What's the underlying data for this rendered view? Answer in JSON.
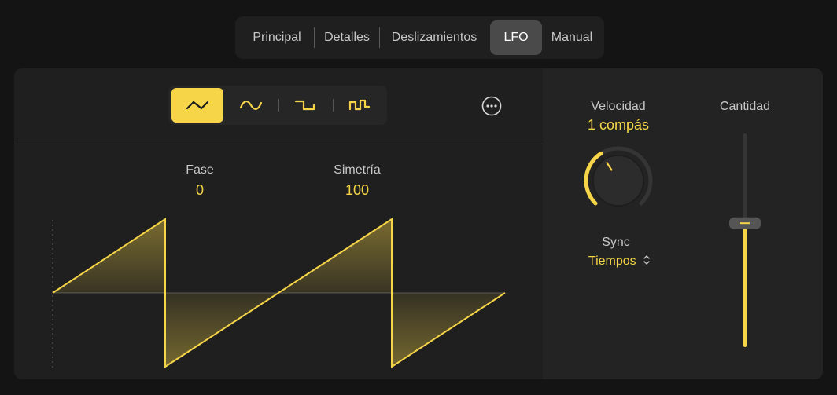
{
  "tabs": [
    {
      "label": "Principal",
      "active": false
    },
    {
      "label": "Detalles",
      "active": false
    },
    {
      "label": "Deslizamientos",
      "active": false
    },
    {
      "label": "LFO",
      "active": true
    },
    {
      "label": "Manual",
      "active": false
    }
  ],
  "waveforms": [
    {
      "icon": "triangle-wave-icon",
      "active": true
    },
    {
      "icon": "sine-wave-icon",
      "active": false
    },
    {
      "icon": "square-wave-icon",
      "active": false
    },
    {
      "icon": "sample-hold-wave-icon",
      "active": false
    }
  ],
  "more_button": {
    "icon": "more-options-icon"
  },
  "phase": {
    "label": "Fase",
    "value": "0"
  },
  "symmetry": {
    "label": "Simetría",
    "value": "100"
  },
  "rate": {
    "label": "Velocidad",
    "value": "1 compás",
    "knob_level": 0.38
  },
  "sync": {
    "label": "Sync",
    "value": "Tiempos",
    "icon": "up-down-chevron-icon"
  },
  "amount": {
    "label": "Cantidad",
    "level": 0.58
  },
  "colors": {
    "accent": "#f7d548",
    "background": "#141414",
    "panel": "#1f1f1f",
    "panel_alt": "#232323",
    "tab_active": "#4a4a4a",
    "text": "#c8c8c8"
  }
}
